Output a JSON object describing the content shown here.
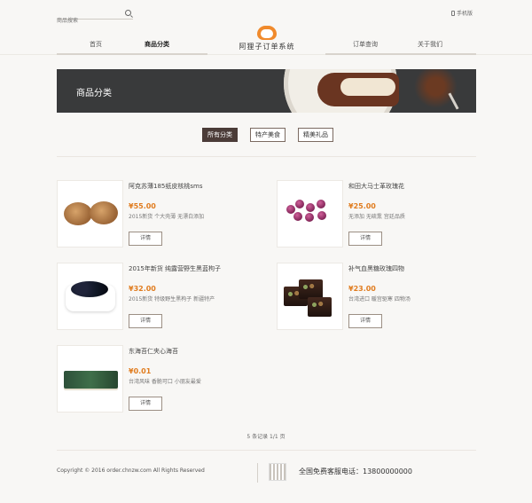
{
  "header": {
    "search_placeholder": "商品搜索",
    "mobile_label": "手机版",
    "logo_text": "阿狸子订单系统",
    "nav": [
      "首页",
      "商品分类",
      "订单查询",
      "关于我们"
    ]
  },
  "banner": {
    "title": "商品分类"
  },
  "filters": [
    "所有分类",
    "特产美食",
    "精美礼品"
  ],
  "products": [
    {
      "name": "阿克苏薄185纸皮核桃sms",
      "price": "¥55.00",
      "desc": "2015新货 个大壳薄 无漂白添加",
      "button": "详情",
      "image": "walnut"
    },
    {
      "name": "和田大马士革玫瑰花",
      "price": "¥25.00",
      "desc": "无添加 无硫熏 宫廷品质",
      "button": "详情",
      "image": "rose"
    },
    {
      "name": "2015年新货 纯露营野生黑蓝枸子",
      "price": "¥32.00",
      "desc": "2015新货 特级野生黑枸子 新疆特产",
      "button": "详情",
      "image": "berry"
    },
    {
      "name": "补气血黑糖玫瑰四物",
      "price": "¥23.00",
      "desc": "台湾进口 暖宫驱寒 四物汤",
      "button": "详情",
      "image": "brownie"
    },
    {
      "name": "东海苔仁夹心海苔",
      "price": "¥0.01",
      "desc": "台湾风味 香脆可口 小朋友最爱",
      "button": "详情",
      "image": "nori"
    }
  ],
  "pagination": "5 条记录 1/1 页",
  "footer": {
    "copyright": "Copyright © 2016 order.chnzw.com All Rights Reserved",
    "hotline": "全国免费客服电话：13800000000"
  }
}
